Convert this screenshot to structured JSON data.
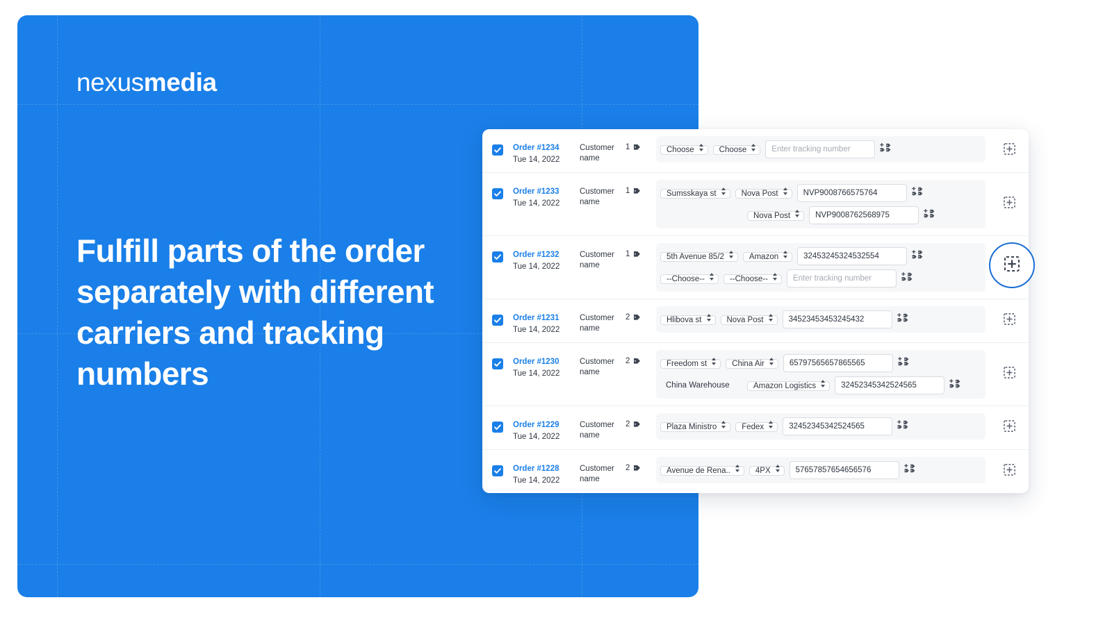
{
  "brand": {
    "logo_light": "nexus",
    "logo_bold": "media",
    "accent_color": "#1a7fe8",
    "headline": "Fulfill parts of the order separately with different carriers and tracking numbers"
  },
  "card": {
    "tracking_placeholder": "Enter tracking number",
    "icons": {
      "checkbox": "checkbox-checked-icon",
      "tag": "tag-icon",
      "add_tags": "add-tags-icon",
      "dashed_add": "dashed-square-plus-icon",
      "select_arrows": "updown-arrows-icon"
    },
    "orders": [
      {
        "id": "Order #1234",
        "date": "Tue 14, 2022",
        "customer": "Customer name",
        "qty": "1",
        "checked": true,
        "show_action": true,
        "fulfillments": [
          {
            "address": "Choose",
            "address_plain": false,
            "carrier": "Choose",
            "tracking": "",
            "tracking_is_placeholder": true
          }
        ]
      },
      {
        "id": "Order #1233",
        "date": "Tue 14, 2022",
        "customer": "Customer name",
        "qty": "1",
        "checked": true,
        "show_action": true,
        "fulfillments": [
          {
            "address": "Sumsskaya st",
            "address_plain": false,
            "carrier": "Nova Post",
            "tracking": "NVP9008766575764",
            "tracking_is_placeholder": false
          },
          {
            "address": "",
            "address_plain": true,
            "carrier": "Nova Post",
            "tracking": "NVP9008762568975",
            "tracking_is_placeholder": false
          }
        ]
      },
      {
        "id": "Order #1232",
        "date": "Tue 14, 2022",
        "customer": "Customer name",
        "qty": "1",
        "checked": true,
        "show_action": true,
        "fulfillments": [
          {
            "address": "5th Avenue 85/2",
            "address_plain": false,
            "carrier": "Amazon",
            "tracking": "32453245324532554",
            "tracking_is_placeholder": false
          },
          {
            "address": "--Choose--",
            "address_plain": false,
            "carrier": "--Choose--",
            "tracking": "",
            "tracking_is_placeholder": true
          }
        ]
      },
      {
        "id": "Order #1231",
        "date": "Tue 14, 2022",
        "customer": "Customer name",
        "qty": "2",
        "checked": true,
        "show_action": true,
        "fulfillments": [
          {
            "address": "Hlibova st",
            "address_plain": false,
            "carrier": "Nova Post",
            "tracking": "34523453453245432",
            "tracking_is_placeholder": false
          }
        ]
      },
      {
        "id": "Order #1230",
        "date": "Tue 14, 2022",
        "customer": "Customer name",
        "qty": "2",
        "checked": true,
        "show_action": true,
        "fulfillments": [
          {
            "address": "Freedom st",
            "address_plain": false,
            "carrier": "China Air",
            "tracking": "65797565657865565",
            "tracking_is_placeholder": false
          },
          {
            "address": "China Warehouse",
            "address_plain": true,
            "carrier": "Amazon Logistics",
            "tracking": "32452345342524565",
            "tracking_is_placeholder": false
          }
        ]
      },
      {
        "id": "Order #1229",
        "date": "Tue 14, 2022",
        "customer": "Customer name",
        "qty": "2",
        "checked": true,
        "show_action": true,
        "fulfillments": [
          {
            "address": "Plaza Ministro",
            "address_plain": false,
            "carrier": "Fedex",
            "tracking": "32452345342524565",
            "tracking_is_placeholder": false
          }
        ]
      },
      {
        "id": "Order #1228",
        "date": "Tue 14, 2022",
        "customer": "Customer name",
        "qty": "2",
        "checked": true,
        "show_action": true,
        "fulfillments": [
          {
            "address": "Avenue de Rena..",
            "address_plain": false,
            "carrier": "4PX",
            "tracking": "57657857654656576",
            "tracking_is_placeholder": false
          }
        ]
      }
    ]
  },
  "highlight": {
    "icon": "dashed-square-plus-icon"
  }
}
